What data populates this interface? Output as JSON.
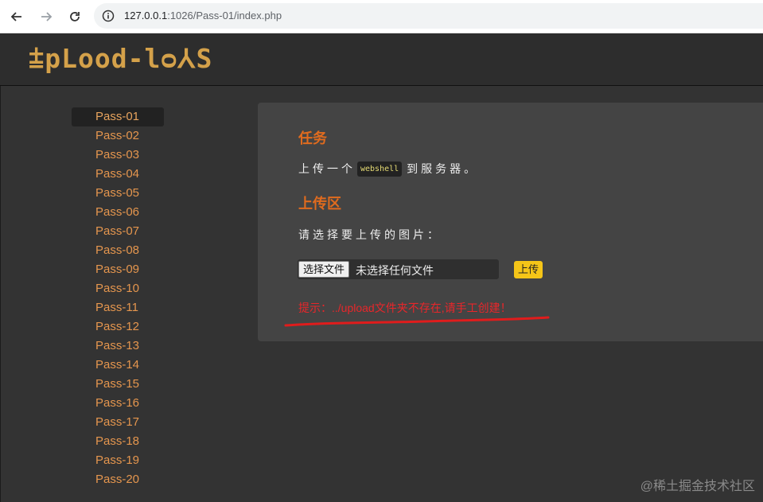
{
  "browser": {
    "url_host": "127.0.0.1",
    "url_rest": ":1026/Pass-01/index.php",
    "icons": {
      "back": "arrow-left-icon",
      "forward": "arrow-right-icon",
      "reload": "reload-icon",
      "info": "info-icon"
    }
  },
  "header": {
    "logo": "⩲pLood-lᴑ⅄S"
  },
  "sidebar": {
    "items": [
      {
        "label": "Pass-01",
        "active": true
      },
      {
        "label": "Pass-02"
      },
      {
        "label": "Pass-03"
      },
      {
        "label": "Pass-04"
      },
      {
        "label": "Pass-05"
      },
      {
        "label": "Pass-06"
      },
      {
        "label": "Pass-07"
      },
      {
        "label": "Pass-08"
      },
      {
        "label": "Pass-09"
      },
      {
        "label": "Pass-10"
      },
      {
        "label": "Pass-11"
      },
      {
        "label": "Pass-12"
      },
      {
        "label": "Pass-13"
      },
      {
        "label": "Pass-14"
      },
      {
        "label": "Pass-15"
      },
      {
        "label": "Pass-16"
      },
      {
        "label": "Pass-17"
      },
      {
        "label": "Pass-18"
      },
      {
        "label": "Pass-19"
      },
      {
        "label": "Pass-20"
      }
    ]
  },
  "panel": {
    "task_title": "任务",
    "task_before": "上传一个",
    "task_code": "webshell",
    "task_after": "到服务器。",
    "upload_title": "上传区",
    "prompt": "请选择要上传的图片：",
    "file_button": "选择文件",
    "file_status": "未选择任何文件",
    "upload_button": "上传",
    "message": "提示：../upload文件夹不存在,请手工创建！"
  },
  "colors": {
    "accent": "#e06b1e",
    "sidebar_link": "#e5964e",
    "error": "#e8262a",
    "button": "#f5c518",
    "logo": "#d4a14a"
  },
  "watermark": "@稀土掘金技术社区"
}
